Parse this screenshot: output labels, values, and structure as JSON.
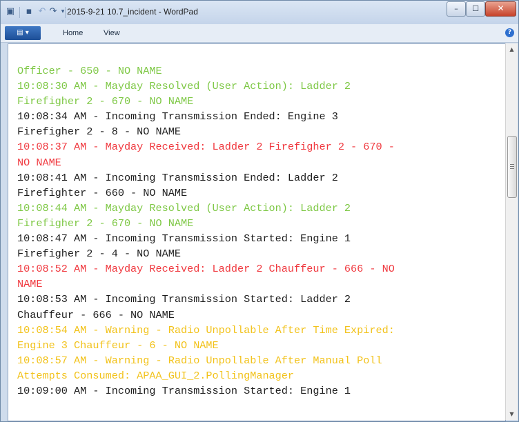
{
  "window": {
    "title": "2015-9-21 10.7_incident - WordPad",
    "controls": {
      "minimize": "–",
      "maximize": "☐",
      "close": "✕"
    }
  },
  "quick_access": {
    "icons": [
      "app-icon",
      "save-icon",
      "undo-icon",
      "redo-icon",
      "customize-dropdown-icon"
    ]
  },
  "ribbon": {
    "file_menu_label": "▤ ▾",
    "tabs": [
      {
        "label": "Home"
      },
      {
        "label": "View"
      }
    ],
    "help_label": "?"
  },
  "document": {
    "lines": [
      {
        "text": "Officer - 650 - NO NAME",
        "color": "#7ec845"
      },
      {
        "text": "10:08:30 AM - Mayday Resolved (User Action): Ladder 2",
        "color": "#7ec845"
      },
      {
        "text": "Firefigher 2 - 670 - NO NAME",
        "color": "#7ec845"
      },
      {
        "text": "10:08:34 AM - Incoming Transmission Ended: Engine 3",
        "color": "#1e1e1e"
      },
      {
        "text": "Firefigher 2 - 8 - NO NAME",
        "color": "#1e1e1e"
      },
      {
        "text": "10:08:37 AM - Mayday Received: Ladder 2 Firefigher 2 - 670 -",
        "color": "#f0393f"
      },
      {
        "text": "NO NAME",
        "color": "#f0393f"
      },
      {
        "text": "10:08:41 AM - Incoming Transmission Ended: Ladder 2",
        "color": "#1e1e1e"
      },
      {
        "text": "Firefighter - 660 - NO NAME",
        "color": "#1e1e1e"
      },
      {
        "text": "10:08:44 AM - Mayday Resolved (User Action): Ladder 2",
        "color": "#7ec845"
      },
      {
        "text": "Firefigher 2 - 670 - NO NAME",
        "color": "#7ec845"
      },
      {
        "text": "10:08:47 AM - Incoming Transmission Started: Engine 1",
        "color": "#1e1e1e"
      },
      {
        "text": "Firefigher 2 - 4 - NO NAME",
        "color": "#1e1e1e"
      },
      {
        "text": "10:08:52 AM - Mayday Received: Ladder 2 Chauffeur - 666 - NO",
        "color": "#f0393f"
      },
      {
        "text": "NAME",
        "color": "#f0393f"
      },
      {
        "text": "10:08:53 AM - Incoming Transmission Started: Ladder 2",
        "color": "#1e1e1e"
      },
      {
        "text": "Chauffeur - 666 - NO NAME",
        "color": "#1e1e1e"
      },
      {
        "text": "10:08:54 AM - Warning - Radio Unpollable After Time Expired:",
        "color": "#f2c21a"
      },
      {
        "text": "Engine 3 Chauffeur - 6 - NO NAME",
        "color": "#f2c21a"
      },
      {
        "text": "10:08:57 AM - Warning - Radio Unpollable After Manual Poll",
        "color": "#f2c21a"
      },
      {
        "text": "Attempts Consumed: APAA_GUI_2.PollingManager",
        "color": "#f2c21a"
      },
      {
        "text": "10:09:00 AM - Incoming Transmission Started: Engine 1",
        "color": "#1e1e1e"
      }
    ]
  },
  "scrollbar": {
    "up_arrow": "▲",
    "down_arrow": "▼"
  }
}
